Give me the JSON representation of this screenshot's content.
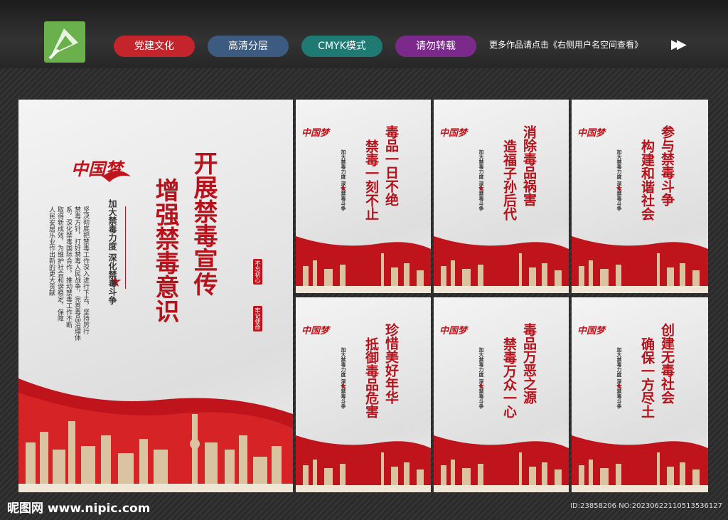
{
  "header": {
    "tags": [
      {
        "label": "党建文化",
        "color": "#c4242b"
      },
      {
        "label": "高清分层",
        "color": "#3d5a80"
      },
      {
        "label": "CMYK模式",
        "color": "#1e7a73"
      },
      {
        "label": "请勿转载",
        "color": "#7b2a8c"
      }
    ],
    "promo": "更多作品请点击《右侧用户名空间查看》",
    "arrows": "▶▶"
  },
  "main_panel": {
    "emblem": "中国梦",
    "title_col1": "开展禁毒宣传",
    "title_col2": "增强禁毒意识",
    "subtitle": "加大禁毒力度  深化禁毒斗争",
    "body_col1": "坚决彻底把禁毒工作深入进行下去，坚持厉行",
    "body_col2": "禁毒方针，打好禁毒人民战争，完善毒品治理体",
    "body_col3": "系，深化禁毒国际合作，推动禁毒工作不断",
    "body_col4": "取得新成效，为维护社会和谐稳定，保障",
    "body_col5": "人民安居乐业作出新的更大贡献",
    "seal1": "不忘初心",
    "seal2": "牢记使命"
  },
  "small_panels": [
    {
      "col1": "毒品一日不绝",
      "col2": "禁毒一刻不止"
    },
    {
      "col1": "消除毒品祸害",
      "col2": "造福子孙后代"
    },
    {
      "col1": "参与禁毒斗争",
      "col2": "构建和谐社会"
    },
    {
      "col1": "珍惜美好年华",
      "col2": "抵御毒品危害"
    },
    {
      "col1": "毒品万恶之源",
      "col2": "禁毒万众一心"
    },
    {
      "col1": "创建无毒社会",
      "col2": "确保一方尽土"
    }
  ],
  "small_common": {
    "emblem": "中国梦",
    "subtitle": "加大禁毒力度  深化禁毒斗争"
  },
  "footer": {
    "site": "昵图网 www.nipic.com",
    "id": "ID:23858206 NO:20230622110513536127"
  }
}
